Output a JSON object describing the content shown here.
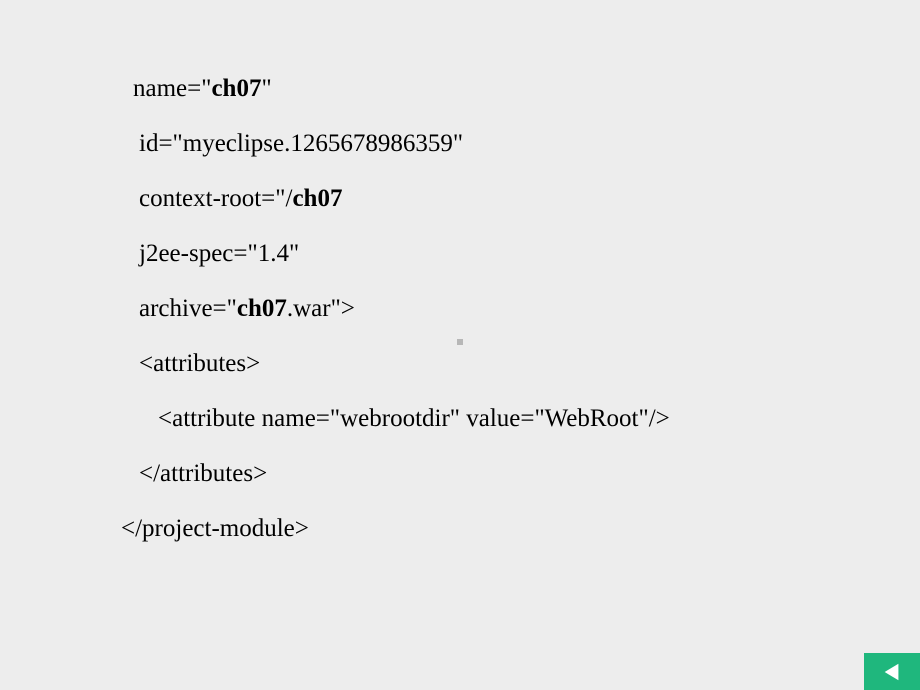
{
  "lines": {
    "name_prefix": " name=\"",
    "name_value": "ch07",
    "name_suffix": "\"",
    "id": "  id=\"myeclipse.1265678986359\"",
    "context_prefix": "  context-root=\"/",
    "context_value": "ch07",
    "context_suffix": "",
    "j2ee": "  j2ee-spec=\"1.4\"",
    "archive_prefix": "  archive=\"",
    "archive_value": "ch07",
    "archive_suffix": ".war\">",
    "attributes_open": "  <attributes>",
    "attribute_element": "    <attribute name=\"webrootdir\" value=\"WebRoot\"/>",
    "attributes_close": "  </attributes>",
    "project_close": "</project-module>"
  }
}
